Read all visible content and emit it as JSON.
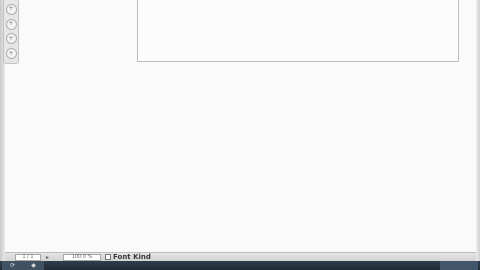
{
  "status_bar": {
    "page_field": "1 / 1",
    "zoom_field": "100.0 %",
    "font_label": "Font Kind"
  },
  "tool_strip": {
    "buttons": [
      "+",
      "+",
      "+",
      "+"
    ]
  }
}
